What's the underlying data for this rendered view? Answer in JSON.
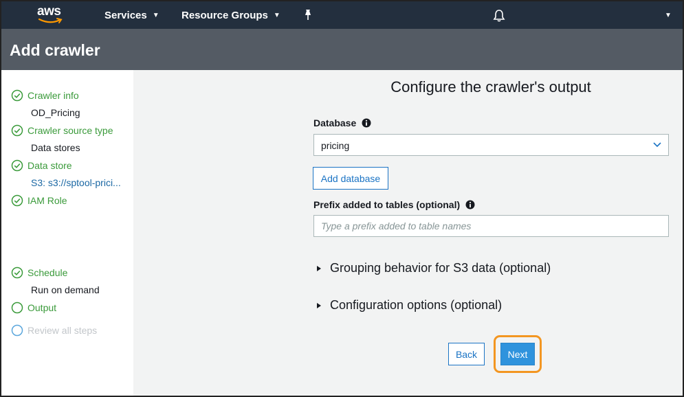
{
  "topnav": {
    "logo_text": "aws",
    "services_label": "Services",
    "resource_groups_label": "Resource Groups"
  },
  "header": {
    "title": "Add crawler"
  },
  "sidebar": {
    "steps": [
      {
        "label": "Crawler info",
        "detail": "OD_Pricing",
        "status": "complete"
      },
      {
        "label": "Crawler source type",
        "detail": "Data stores",
        "status": "complete"
      },
      {
        "label": "Data store",
        "detail": "S3: s3://sptool-prici...",
        "status": "complete"
      },
      {
        "label": "IAM Role",
        "detail": "",
        "status": "complete"
      },
      {
        "label": "Schedule",
        "detail": "Run on demand",
        "status": "complete"
      },
      {
        "label": "Output",
        "detail": "",
        "status": "current"
      },
      {
        "label": "Review all steps",
        "detail": "",
        "status": "disabled"
      }
    ]
  },
  "main": {
    "title": "Configure the crawler's output",
    "database": {
      "label": "Database",
      "value": "pricing"
    },
    "add_database_label": "Add database",
    "prefix": {
      "label": "Prefix added to tables (optional)",
      "placeholder": "Type a prefix added to table names",
      "value": ""
    },
    "grouping_label": "Grouping behavior for S3 data (optional)",
    "config_label": "Configuration options (optional)",
    "back_label": "Back",
    "next_label": "Next"
  },
  "colors": {
    "nav_bg": "#232f3e",
    "header_bg": "#545b64",
    "step_complete": "#3a9a3a",
    "primary": "#2f93dd",
    "highlight": "#f39621"
  }
}
